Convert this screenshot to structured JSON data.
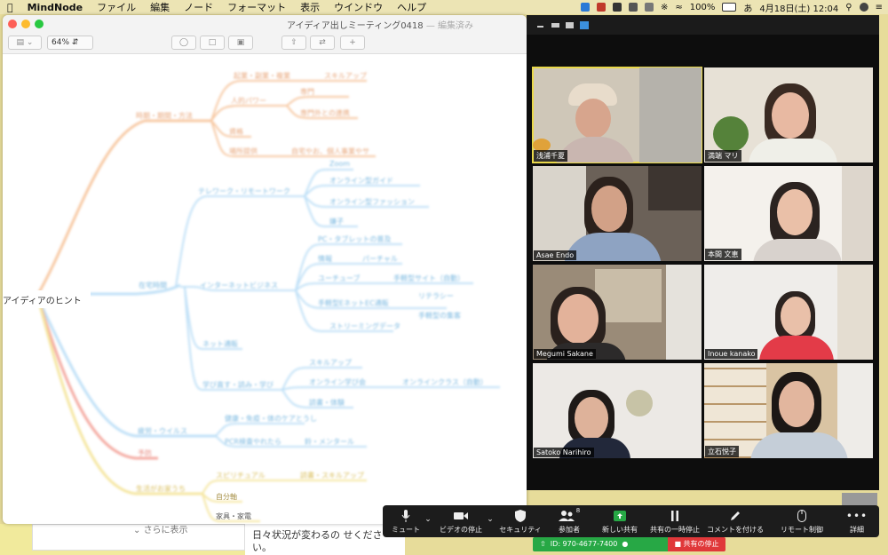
{
  "menubar": {
    "items": [
      "MindNode",
      "ファイル",
      "編集",
      "ノード",
      "フォーマット",
      "表示",
      "ウインドウ",
      "ヘルプ"
    ],
    "battery": "100%",
    "clock": "4月18日(土)  12:04",
    "input_mode": "あ"
  },
  "mindnode": {
    "window_title": "アイディア出しミーティング0418",
    "window_subtitle": " — 編集済み",
    "zoom": "64%",
    "root": "アイディアのヒント",
    "more_link": "さらに表示",
    "colors": {
      "orange": "#f7c8a2",
      "blue": "#bfe0f7",
      "yellow": "#f5e6a0",
      "red": "#f4a9a0",
      "root_bg": "#ffffff"
    },
    "nodes": {
      "orange": [
        "時期・期間・方法",
        "起業・副業・複業",
        "スキルアップ",
        "人的パワー",
        "専門",
        "専門外との連携",
        "資格",
        "場所提供",
        "自宅やお、個人事業やサ"
      ],
      "blue1": [
        "テレワーク・リモートワーク",
        "Zoom",
        "オンライン型ガイド",
        "オンライン型ファッション",
        "嫌子"
      ],
      "blue2": [
        "在宅時間",
        "インターネットビジネス",
        "PC・タブレットの普及",
        "情報",
        "パーチャル",
        "ユーチューブ",
        "手軽型サイト（自動）",
        "手軽型EネットEC通販",
        "リテラシー",
        "手軽型の集客",
        "ストリーミングデータ"
      ],
      "blue3": [
        "ネット通販",
        "学び直す・読み・学び",
        "スキルアップ",
        "オンライン学び会",
        "オンラインクラス（自動）",
        "読書・体験"
      ],
      "blue4": [
        "疲労・ウイルス",
        "健康・免疫・体のケアとうし",
        "PCR検査やれたら",
        "鈴・メンタール"
      ],
      "red": [
        "予防"
      ],
      "yellow": [
        "生活がお家うち",
        "スピリチュアル",
        "読書・スキルアップ",
        "自分軸",
        "家具・家電"
      ]
    }
  },
  "desktop": {
    "note_text": "日々状況が変わるの せください。"
  },
  "zoom": {
    "participants": [
      {
        "name": "浅浦千夏",
        "active": true
      },
      {
        "name": "満端 マリ",
        "active": false
      },
      {
        "name": "Asae Endo",
        "active": false
      },
      {
        "name": "本間 文恵",
        "active": false
      },
      {
        "name": "Megumi Sakane",
        "active": false
      },
      {
        "name": "Inoue kanako",
        "active": false
      },
      {
        "name": "Satoko  Narihiro",
        "active": false
      },
      {
        "name": "立石悦子",
        "active": false
      }
    ],
    "controls": [
      {
        "label": "ミュート",
        "icon": "microphone-icon"
      },
      {
        "label": "ビデオの停止",
        "icon": "video-camera-icon"
      },
      {
        "label": "セキュリティ",
        "icon": "shield-icon"
      },
      {
        "label": "参加者",
        "icon": "participants-icon",
        "count": "8"
      },
      {
        "label": "新しい共有",
        "icon": "share-screen-icon"
      },
      {
        "label": "共有の一時停止",
        "icon": "pause-icon"
      },
      {
        "label": "コメントを付ける",
        "icon": "pencil-icon"
      },
      {
        "label": "リモート制御",
        "icon": "mouse-icon"
      },
      {
        "label": "詳細",
        "icon": "more-icon"
      }
    ],
    "meeting_id": "ID: 970-4677-7400",
    "stop_share": "共有の停止",
    "accent": "#27a845",
    "danger": "#e0383a"
  }
}
